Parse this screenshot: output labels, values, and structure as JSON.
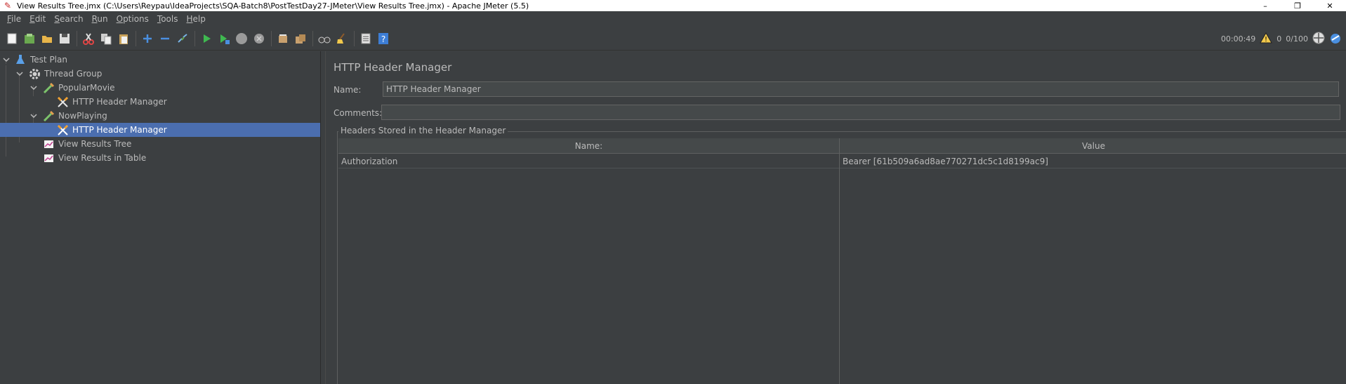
{
  "window": {
    "title": "View Results Tree.jmx (C:\\Users\\Reypau\\IdeaProjects\\SQA-Batch8\\PostTestDay27-JMeter\\View Results Tree.jmx) - Apache JMeter (5.5)",
    "minimize": "–",
    "maximize": "❐",
    "close": "✕"
  },
  "menu": [
    {
      "label": "File",
      "mnemonic": "F",
      "rest": "ile"
    },
    {
      "label": "Edit",
      "mnemonic": "E",
      "rest": "dit"
    },
    {
      "label": "Search",
      "mnemonic": "S",
      "rest": "earch"
    },
    {
      "label": "Run",
      "mnemonic": "R",
      "rest": "un"
    },
    {
      "label": "Options",
      "mnemonic": "O",
      "rest": "ptions"
    },
    {
      "label": "Tools",
      "mnemonic": "T",
      "rest": "ools"
    },
    {
      "label": "Help",
      "mnemonic": "H",
      "rest": "elp"
    }
  ],
  "toolbar": {
    "elapsed_time": "00:00:49",
    "warning_count": "0",
    "threads": "0/100"
  },
  "tree": {
    "nodes": [
      {
        "label": "Test Plan",
        "icon": "flask-icon"
      },
      {
        "label": "Thread Group",
        "icon": "gear-icon"
      },
      {
        "label": "PopularMovie",
        "icon": "pipette-icon"
      },
      {
        "label": "HTTP Header Manager",
        "icon": "tools-icon"
      },
      {
        "label": "NowPlaying",
        "icon": "pipette-icon"
      },
      {
        "label": "HTTP Header Manager",
        "icon": "tools-icon"
      },
      {
        "label": "View Results Tree",
        "icon": "chart-icon"
      },
      {
        "label": "View Results in Table",
        "icon": "chart-icon"
      }
    ]
  },
  "editor": {
    "title": "HTTP Header Manager",
    "name_label": "Name:",
    "name_value": "HTTP Header Manager",
    "comments_label": "Comments:",
    "comments_value": "",
    "group_title": "Headers Stored in the Header Manager",
    "table": {
      "columns": [
        "Name:",
        "Value"
      ],
      "rows": [
        [
          "Authorization",
          "Bearer [61b509a6ad8ae770271dc5c1d8199ac9]"
        ]
      ]
    }
  },
  "colors": {
    "background": "#3c3f41",
    "selection": "#4b6eaf",
    "text": "#bbbbbb"
  }
}
